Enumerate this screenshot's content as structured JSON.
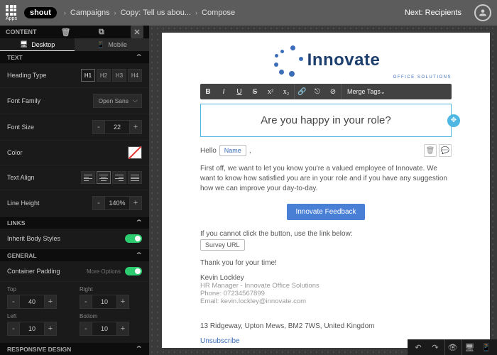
{
  "topbar": {
    "apps": "Apps",
    "brand": "shout",
    "crumbs": [
      "Campaigns",
      "Copy: Tell us abou...",
      "Compose"
    ],
    "next": "Next: Recipients"
  },
  "side": {
    "content_label": "CONTENT",
    "tabs": {
      "desktop": "Desktop",
      "mobile": "Mobile"
    },
    "sections": {
      "text": "TEXT",
      "links": "LINKS",
      "general": "GENERAL",
      "responsive": "RESPONSIVE DESIGN"
    },
    "fields": {
      "heading_type": "Heading Type",
      "h_options": [
        "H1",
        "H2",
        "H3",
        "H4"
      ],
      "font_family": "Font Family",
      "font_family_value": "Open Sans",
      "font_size": "Font Size",
      "font_size_value": "22",
      "color": "Color",
      "text_align": "Text Align",
      "line_height": "Line Height",
      "line_height_value": "140%",
      "inherit_body": "Inherit Body Styles",
      "container_padding": "Container Padding",
      "more_options": "More Options",
      "pad_labels": {
        "top": "Top",
        "right": "Right",
        "left": "Left",
        "bottom": "Bottom"
      },
      "pad_values": {
        "top": "40",
        "right": "10",
        "left": "10",
        "bottom": "10"
      }
    }
  },
  "email": {
    "logo_text": "Innovate",
    "logo_sub": "OFFICE SOLUTIONS",
    "toolbar": {
      "merge_tags": "Merge Tags"
    },
    "headline": "Are you happy in your role?",
    "greeting": "Hello",
    "name_chip": "Name",
    "body": "First off, we want to let you know you're a valued employee of Innovate. We want to know how satisfied you are in your role and if you have any suggestion how we can improve your day-to-day.",
    "cta": "Innovate Feedback",
    "link_help": "If you cannot click the button, use the link below:",
    "survey_chip": "Survey URL",
    "thanks": "Thank you for your time!",
    "sig_name": "Kevin Lockley",
    "sig_title": "HR Manager - Innovate Office Solutions",
    "sig_phone": "Phone: 07234567899",
    "sig_email": "Email: kevin.lockley@innovate.com",
    "address": "13 Ridgeway, Upton Mews, BM2 7WS, United Kingdom",
    "unsubscribe": "Unsubscribe"
  }
}
